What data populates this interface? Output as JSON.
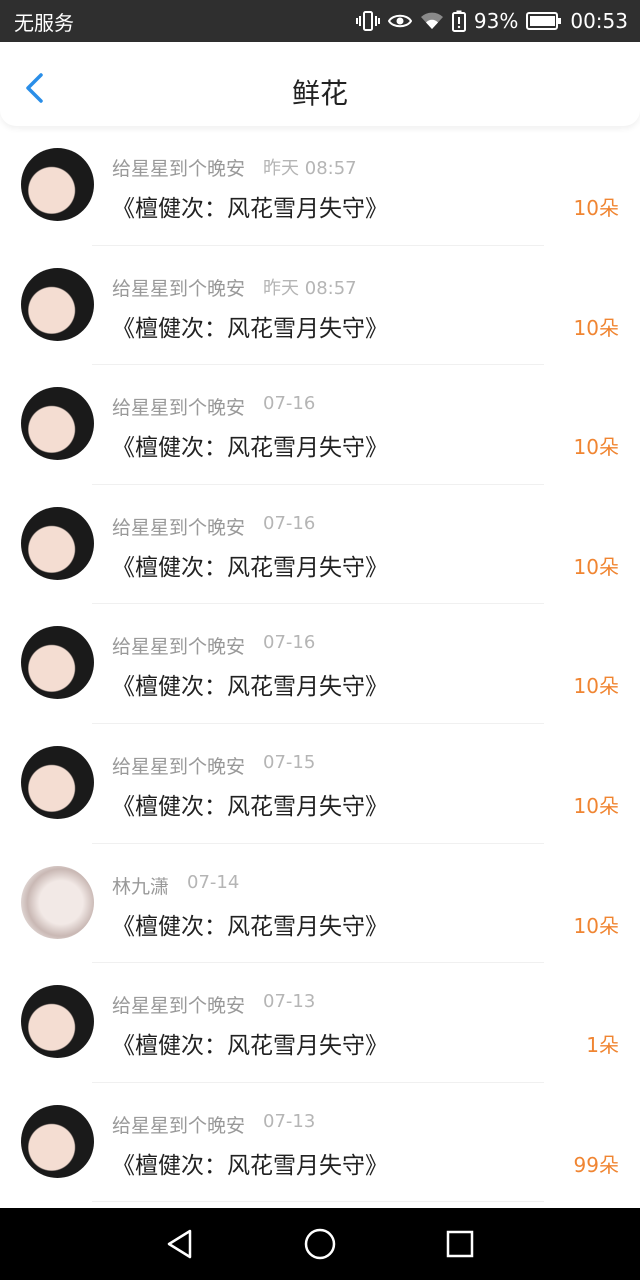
{
  "status_bar": {
    "carrier": "无服务",
    "battery": "93%",
    "time": "00:53",
    "icons": [
      "vibrate-icon",
      "eye-icon",
      "wifi-icon",
      "battery-alert-icon",
      "battery-icon"
    ]
  },
  "header": {
    "title": "鲜花",
    "back_icon": "chevron-left-icon",
    "accent": "#2a8ee8"
  },
  "colors": {
    "count": "#f08532",
    "name": "#999999",
    "title_text": "#222222"
  },
  "items": [
    {
      "name": "给星星到个晚安",
      "time": "昨天 08:57",
      "title": "《檀健次：风花雪月失守》",
      "count": "10朵",
      "avatar": "avatar-a"
    },
    {
      "name": "给星星到个晚安",
      "time": "昨天 08:57",
      "title": "《檀健次：风花雪月失守》",
      "count": "10朵",
      "avatar": "avatar-a"
    },
    {
      "name": "给星星到个晚安",
      "time": "07-16",
      "title": "《檀健次：风花雪月失守》",
      "count": "10朵",
      "avatar": "avatar-a"
    },
    {
      "name": "给星星到个晚安",
      "time": "07-16",
      "title": "《檀健次：风花雪月失守》",
      "count": "10朵",
      "avatar": "avatar-a"
    },
    {
      "name": "给星星到个晚安",
      "time": "07-16",
      "title": "《檀健次：风花雪月失守》",
      "count": "10朵",
      "avatar": "avatar-a"
    },
    {
      "name": "给星星到个晚安",
      "time": "07-15",
      "title": "《檀健次：风花雪月失守》",
      "count": "10朵",
      "avatar": "avatar-a"
    },
    {
      "name": "林九潇",
      "time": "07-14",
      "title": "《檀健次：风花雪月失守》",
      "count": "10朵",
      "avatar": "avatar-b"
    },
    {
      "name": "给星星到个晚安",
      "time": "07-13",
      "title": "《檀健次：风花雪月失守》",
      "count": "1朵",
      "avatar": "avatar-a"
    },
    {
      "name": "给星星到个晚安",
      "time": "07-13",
      "title": "《檀健次：风花雪月失守》",
      "count": "99朵",
      "avatar": "avatar-a"
    }
  ],
  "system_nav": {
    "buttons": [
      "back-triangle-icon",
      "home-circle-icon",
      "recents-square-icon"
    ]
  }
}
